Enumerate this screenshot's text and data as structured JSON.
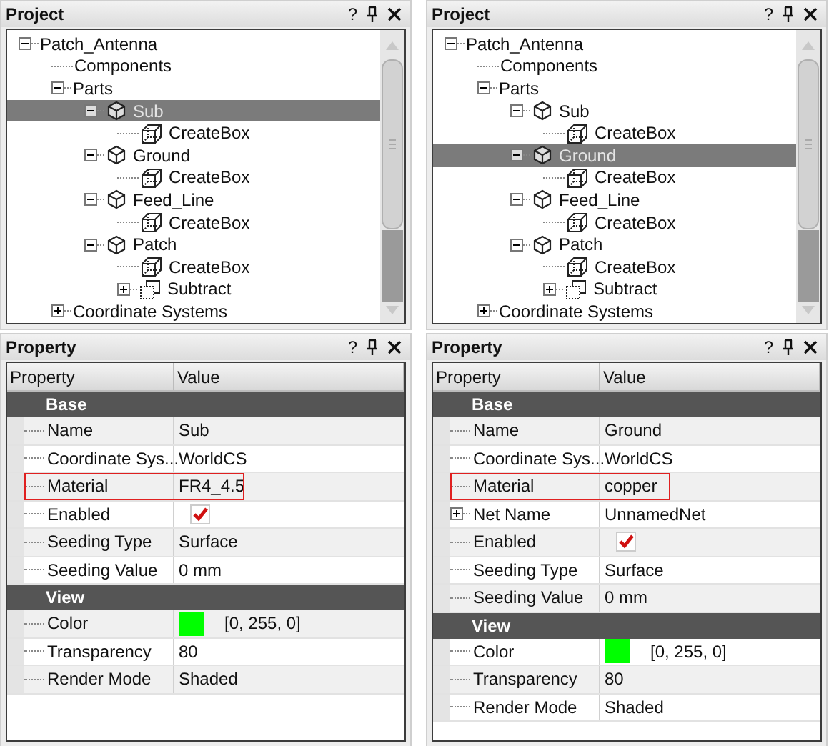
{
  "columns": [
    {
      "project": {
        "title": "Project",
        "help": "?",
        "tree": [
          {
            "label": "Patch_Antenna",
            "expanded": true,
            "selected": false,
            "children": [
              {
                "label": "Components",
                "selected": false
              },
              {
                "label": "Parts",
                "expanded": true,
                "selected": false,
                "children": [
                  {
                    "label": "Sub",
                    "kind": "part",
                    "expanded": true,
                    "selected": true,
                    "children": [
                      {
                        "label": "CreateBox",
                        "kind": "operation",
                        "selected": false
                      }
                    ]
                  },
                  {
                    "label": "Ground",
                    "kind": "part",
                    "expanded": true,
                    "selected": false,
                    "children": [
                      {
                        "label": "CreateBox",
                        "kind": "operation",
                        "selected": false
                      }
                    ]
                  },
                  {
                    "label": "Feed_Line",
                    "kind": "part",
                    "expanded": true,
                    "selected": false,
                    "children": [
                      {
                        "label": "CreateBox",
                        "kind": "operation",
                        "selected": false
                      }
                    ]
                  },
                  {
                    "label": "Patch",
                    "kind": "part",
                    "expanded": true,
                    "selected": false,
                    "children": [
                      {
                        "label": "CreateBox",
                        "kind": "operation",
                        "selected": false
                      },
                      {
                        "label": "Subtract",
                        "kind": "subtract",
                        "expanded": false,
                        "selected": false
                      }
                    ]
                  }
                ]
              },
              {
                "label": "Coordinate Systems",
                "expanded": false,
                "selected": false
              }
            ]
          }
        ]
      },
      "property": {
        "title": "Property",
        "help": "?",
        "headers": [
          "Property",
          "Value"
        ],
        "groups": [
          {
            "label": "Base",
            "rows": [
              {
                "label": "Name",
                "kind": "text",
                "value": "Sub",
                "highlighted": false
              },
              {
                "label": "Coordinate Sys...",
                "kind": "text",
                "value": "WorldCS",
                "highlighted": false
              },
              {
                "label": "Material",
                "kind": "text",
                "value": "FR4_4.5",
                "highlighted": true
              },
              {
                "label": "Enabled",
                "kind": "checkbox",
                "checked": true,
                "highlighted": false
              },
              {
                "label": "Seeding Type",
                "kind": "text",
                "value": "Surface",
                "highlighted": false
              },
              {
                "label": "Seeding Value",
                "kind": "text",
                "value": "0 mm",
                "highlighted": false
              }
            ]
          },
          {
            "label": "View",
            "rows": [
              {
                "label": "Color",
                "kind": "color",
                "color": "#00ff00",
                "value": "[0, 255, 0]",
                "highlighted": false
              },
              {
                "label": "Transparency",
                "kind": "text",
                "value": "80",
                "highlighted": false
              },
              {
                "label": "Render Mode",
                "kind": "text",
                "value": "Shaded",
                "highlighted": false
              }
            ]
          }
        ]
      }
    },
    {
      "project": {
        "title": "Project",
        "help": "?",
        "tree": [
          {
            "label": "Patch_Antenna",
            "expanded": true,
            "selected": false,
            "children": [
              {
                "label": "Components",
                "selected": false
              },
              {
                "label": "Parts",
                "expanded": true,
                "selected": false,
                "children": [
                  {
                    "label": "Sub",
                    "kind": "part",
                    "expanded": true,
                    "selected": false,
                    "children": [
                      {
                        "label": "CreateBox",
                        "kind": "operation",
                        "selected": false
                      }
                    ]
                  },
                  {
                    "label": "Ground",
                    "kind": "part",
                    "expanded": true,
                    "selected": true,
                    "children": [
                      {
                        "label": "CreateBox",
                        "kind": "operation",
                        "selected": false
                      }
                    ]
                  },
                  {
                    "label": "Feed_Line",
                    "kind": "part",
                    "expanded": true,
                    "selected": false,
                    "children": [
                      {
                        "label": "CreateBox",
                        "kind": "operation",
                        "selected": false
                      }
                    ]
                  },
                  {
                    "label": "Patch",
                    "kind": "part",
                    "expanded": true,
                    "selected": false,
                    "children": [
                      {
                        "label": "CreateBox",
                        "kind": "operation",
                        "selected": false
                      },
                      {
                        "label": "Subtract",
                        "kind": "subtract",
                        "expanded": false,
                        "selected": false
                      }
                    ]
                  }
                ]
              },
              {
                "label": "Coordinate Systems",
                "expanded": false,
                "selected": false
              }
            ]
          }
        ]
      },
      "property": {
        "title": "Property",
        "help": "?",
        "headers": [
          "Property",
          "Value"
        ],
        "groups": [
          {
            "label": "Base",
            "rows": [
              {
                "label": "Name",
                "kind": "text",
                "value": "Ground",
                "highlighted": false
              },
              {
                "label": "Coordinate Sys...",
                "kind": "text",
                "value": "WorldCS",
                "highlighted": false
              },
              {
                "label": "Material",
                "kind": "text",
                "value": "copper",
                "highlighted": true
              },
              {
                "label": "Net Name",
                "kind": "text",
                "value": "UnnamedNet",
                "expanded": false,
                "highlighted": false
              },
              {
                "label": "Enabled",
                "kind": "checkbox",
                "checked": true,
                "highlighted": false
              },
              {
                "label": "Seeding Type",
                "kind": "text",
                "value": "Surface",
                "highlighted": false
              },
              {
                "label": "Seeding Value",
                "kind": "text",
                "value": "0 mm",
                "highlighted": false
              }
            ]
          },
          {
            "label": "View",
            "rows": [
              {
                "label": "Color",
                "kind": "color",
                "color": "#00ff00",
                "value": "[0, 255, 0]",
                "highlighted": false
              },
              {
                "label": "Transparency",
                "kind": "text",
                "value": "80",
                "highlighted": false
              },
              {
                "label": "Render Mode",
                "kind": "text",
                "value": "Shaded",
                "highlighted": false
              }
            ]
          }
        ]
      }
    }
  ]
}
